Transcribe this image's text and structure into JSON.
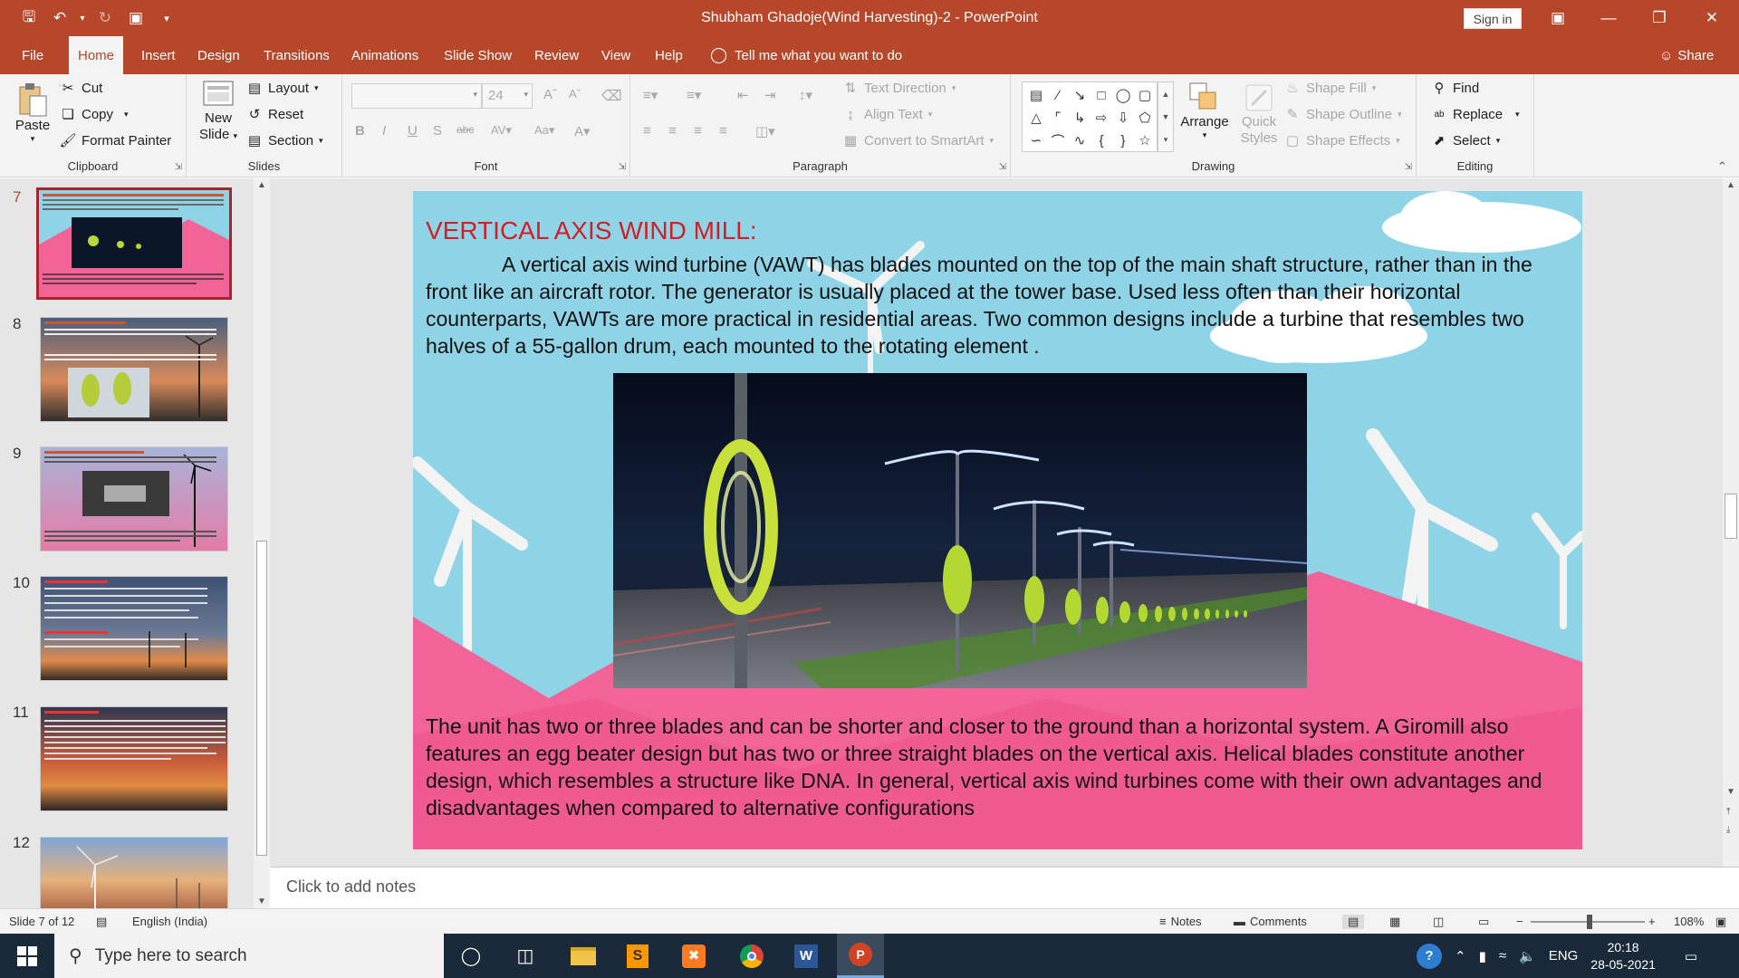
{
  "window": {
    "title": "Shubham Ghadoje(Wind Harvesting)-2  -  PowerPoint",
    "sign_in": "Sign in",
    "colors": {
      "accent": "#b7472a",
      "title_red": "#d31e26",
      "slide_sky": "#8fd3e6",
      "slide_pink": "#f26398"
    }
  },
  "tabs": [
    "File",
    "Home",
    "Insert",
    "Design",
    "Transitions",
    "Animations",
    "Slide Show",
    "Review",
    "View",
    "Help"
  ],
  "tell_me": "Tell me what you want to do",
  "share": "Share",
  "ribbon": {
    "clipboard": {
      "label": "Clipboard",
      "paste": "Paste",
      "cut": "Cut",
      "copy": "Copy",
      "format_painter": "Format Painter"
    },
    "slides": {
      "label": "Slides",
      "new_slide_1": "New",
      "new_slide_2": "Slide",
      "layout": "Layout",
      "reset": "Reset",
      "section": "Section"
    },
    "font": {
      "label": "Font",
      "size": "24"
    },
    "paragraph": {
      "label": "Paragraph",
      "text_direction": "Text Direction",
      "align_text": "Align Text",
      "convert_smartart": "Convert to SmartArt"
    },
    "drawing": {
      "label": "Drawing",
      "arrange": "Arrange",
      "quick_styles_1": "Quick",
      "quick_styles_2": "Styles",
      "shape_fill": "Shape Fill",
      "shape_outline": "Shape Outline",
      "shape_effects": "Shape Effects"
    },
    "editing": {
      "label": "Editing",
      "find": "Find",
      "replace": "Replace",
      "select": "Select"
    }
  },
  "thumbnails": [
    {
      "num": "7",
      "selected": true,
      "title": "VERTICAL AXIS WIND MILL:"
    },
    {
      "num": "8",
      "selected": false,
      "title": ""
    },
    {
      "num": "9",
      "selected": false,
      "title": ""
    },
    {
      "num": "10",
      "selected": false,
      "title": ""
    },
    {
      "num": "11",
      "selected": false,
      "title": ""
    },
    {
      "num": "12",
      "selected": false,
      "title": ""
    }
  ],
  "slide": {
    "title": "VERTICAL AXIS WIND MILL:",
    "para1": "A vertical axis wind turbine (VAWT) has blades mounted on the top of the main shaft structure, rather than in the front like an aircraft rotor. The generator is usually placed at the tower base. Used less often than their horizontal counterparts, VAWTs are more practical in residential areas. Two common designs include a turbine that resembles two halves of a 55-gallon drum, each mounted to the rotating element .",
    "para2": "The unit has two or three blades and can be shorter and closer to the ground than a horizontal system. A Giromill also features an egg beater design but has two or three straight blades on the vertical axis. Helical blades constitute another design, which resembles a structure like DNA. In general, vertical axis wind turbines come with their own advantages and disadvantages when compared to alternative configurations"
  },
  "notes_placeholder": "Click to add notes",
  "status": {
    "slide_of": "Slide 7 of 12",
    "language": "English (India)",
    "notes": "Notes",
    "comments": "Comments",
    "zoom": "108%",
    "zoom_level_percent": 108
  },
  "taskbar": {
    "search_placeholder": "Type here to search",
    "lang": "ENG",
    "time": "20:18",
    "date": "28-05-2021"
  }
}
